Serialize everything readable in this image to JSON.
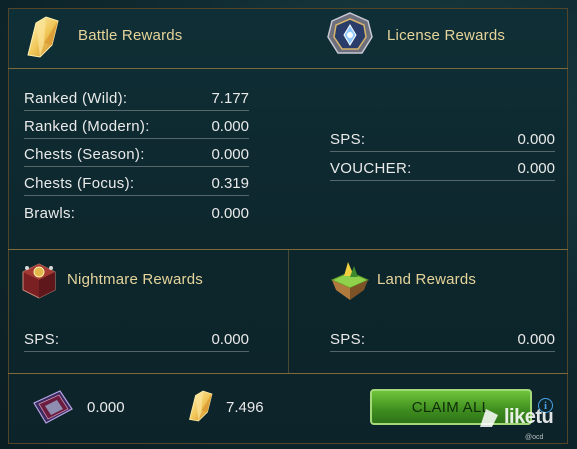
{
  "battle": {
    "title": "Battle Rewards",
    "rows": [
      {
        "label": "Ranked (Wild):",
        "value": "7.177"
      },
      {
        "label": "Ranked (Modern):",
        "value": "0.000"
      },
      {
        "label": "Chests (Season):",
        "value": "0.000"
      },
      {
        "label": "Chests (Focus):",
        "value": "0.319"
      },
      {
        "label": "Brawls:",
        "value": "0.000"
      }
    ]
  },
  "license": {
    "title": "License Rewards",
    "rows": [
      {
        "label": "SPS:",
        "value": "0.000"
      },
      {
        "label": "VOUCHER:",
        "value": "0.000"
      }
    ]
  },
  "nightmare": {
    "title": "Nightmare Rewards",
    "rows": [
      {
        "label": "SPS:",
        "value": "0.000"
      }
    ]
  },
  "land": {
    "title": "Land Rewards",
    "rows": [
      {
        "label": "SPS:",
        "value": "0.000"
      }
    ]
  },
  "footer": {
    "voucher_total": "0.000",
    "sps_total": "7.496",
    "claim_label": "CLAIM ALL",
    "info_glyph": "i"
  },
  "watermark": {
    "text": "liketu",
    "subtext": "@ocd"
  },
  "colors": {
    "title_gold": "#e6d49a",
    "border_gold": "#7d6a3a",
    "claim_green": "#4fa62a",
    "info_blue": "#4aa3e8"
  },
  "icons": [
    "sps-crystal-icon",
    "license-emblem-icon",
    "nightmare-chest-icon",
    "land-island-icon",
    "voucher-card-icon",
    "sps-crystal-icon",
    "info-icon"
  ]
}
